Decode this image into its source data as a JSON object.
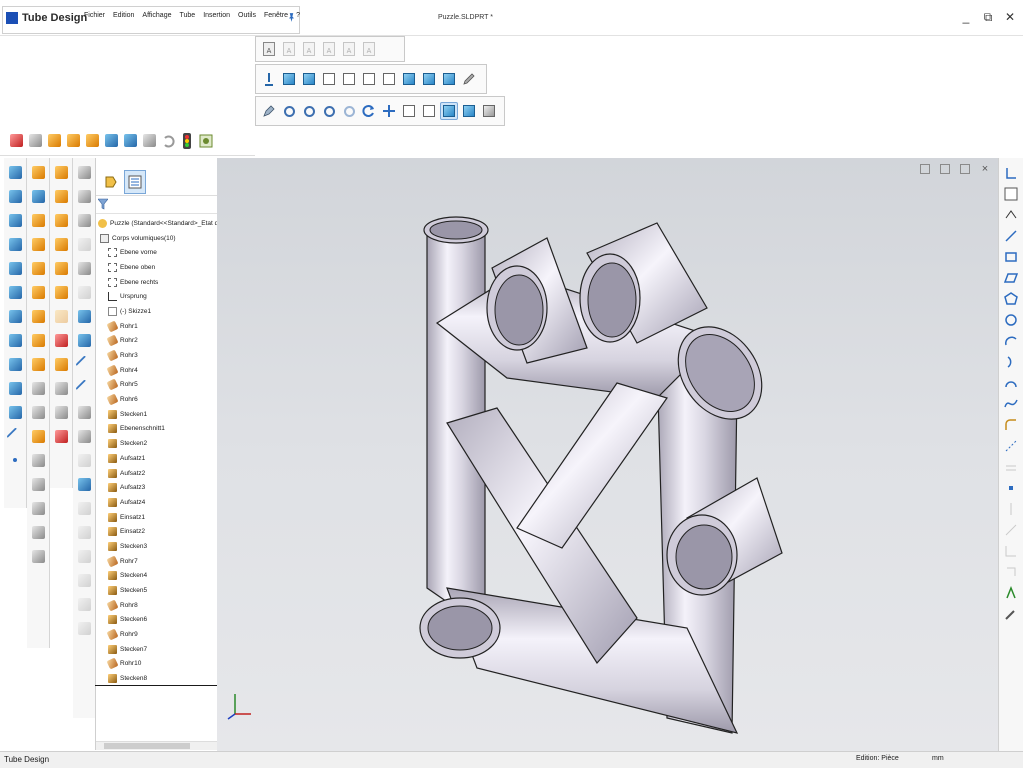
{
  "app": {
    "name": "Tube Design",
    "file_title": "Puzzle.SLDPRT *"
  },
  "menu": [
    "Fichier",
    "Edition",
    "Affichage",
    "Tube",
    "Insertion",
    "Outils",
    "Fenêtre",
    "?"
  ],
  "window_controls": {
    "minimize": "_",
    "restore": "⧉",
    "close": "✕"
  },
  "tree": {
    "items": [
      {
        "label": "Puzzle  (Standard<<Standard>_Etat d'affic",
        "icon": "part"
      },
      {
        "label": "Corps volumiques(10)",
        "icon": "body"
      },
      {
        "label": "Ebene vorne",
        "icon": "plane"
      },
      {
        "label": "Ebene oben",
        "icon": "plane"
      },
      {
        "label": "Ebene rechts",
        "icon": "plane"
      },
      {
        "label": "Ursprung",
        "icon": "origin"
      },
      {
        "label": "(-) Skizze1",
        "icon": "sketch"
      },
      {
        "label": "Rohr1",
        "icon": "tube"
      },
      {
        "label": "Rohr2",
        "icon": "tube"
      },
      {
        "label": "Rohr3",
        "icon": "tube"
      },
      {
        "label": "Rohr4",
        "icon": "tube"
      },
      {
        "label": "Rohr5",
        "icon": "tube"
      },
      {
        "label": "Rohr6",
        "icon": "tube"
      },
      {
        "label": "Stecken1",
        "icon": "conn"
      },
      {
        "label": "Ebenenschnitt1",
        "icon": "conn"
      },
      {
        "label": "Stecken2",
        "icon": "conn"
      },
      {
        "label": "Aufsatz1",
        "icon": "conn"
      },
      {
        "label": "Aufsatz2",
        "icon": "conn"
      },
      {
        "label": "Aufsatz3",
        "icon": "conn"
      },
      {
        "label": "Aufsatz4",
        "icon": "conn"
      },
      {
        "label": "Einsatz1",
        "icon": "conn"
      },
      {
        "label": "Einsatz2",
        "icon": "conn"
      },
      {
        "label": "Stecken3",
        "icon": "conn"
      },
      {
        "label": "Rohr7",
        "icon": "tube"
      },
      {
        "label": "Stecken4",
        "icon": "conn"
      },
      {
        "label": "Stecken5",
        "icon": "conn"
      },
      {
        "label": "Rohr8",
        "icon": "tube"
      },
      {
        "label": "Stecken6",
        "icon": "conn"
      },
      {
        "label": "Rohr9",
        "icon": "tube"
      },
      {
        "label": "Stecken7",
        "icon": "conn"
      },
      {
        "label": "Rohr10",
        "icon": "tube"
      },
      {
        "label": "Stecken8",
        "icon": "conn"
      }
    ]
  },
  "status": {
    "left": "Tube Design",
    "mode": "Edition: Pièce",
    "unit": "mm"
  },
  "colors": {
    "brand": "#1b4fb5",
    "viewport_top": "#d2d5da",
    "tube_light": "#f4f2fa",
    "tube_dark": "#a9a5b5"
  }
}
